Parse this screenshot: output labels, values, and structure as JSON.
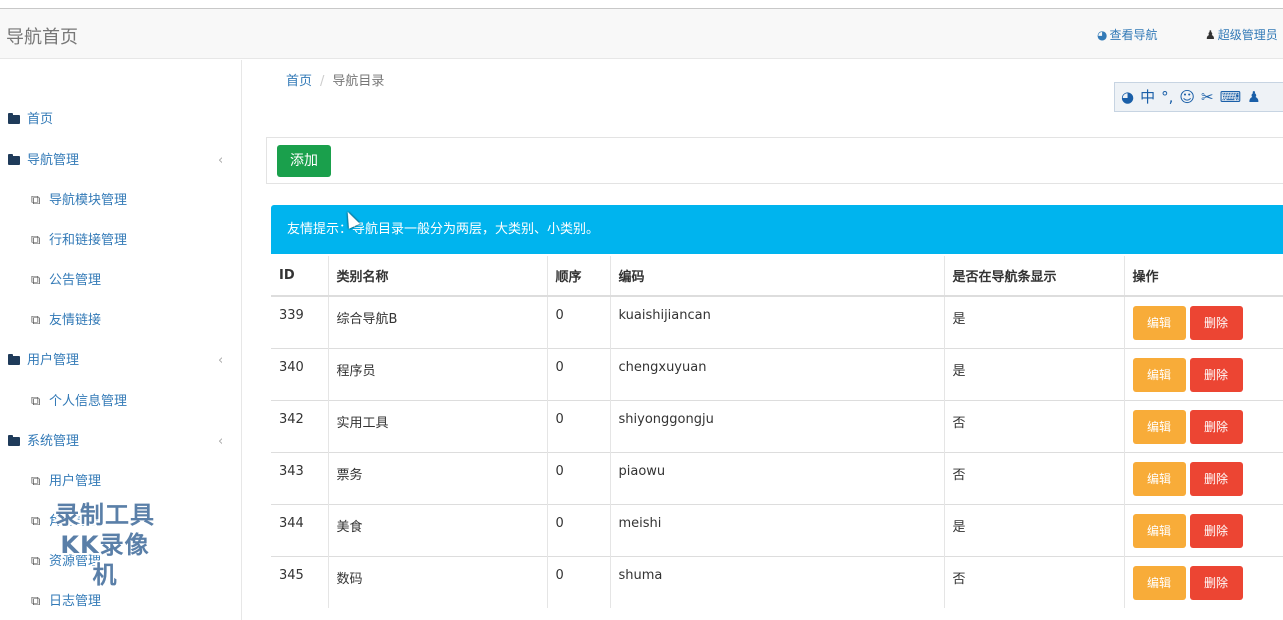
{
  "header": {
    "brand": "导航首页",
    "links": [
      {
        "icon": "globe-icon",
        "glyph": "◕",
        "label": "查看导航"
      },
      {
        "icon": "user-icon",
        "glyph": "♟",
        "label": "超级管理员"
      }
    ]
  },
  "sidebar": {
    "items": [
      {
        "type": "section",
        "label": "首页",
        "arrow": ""
      },
      {
        "type": "section",
        "label": "导航管理",
        "arrow": "‹"
      },
      {
        "type": "sub",
        "label": "导航模块管理"
      },
      {
        "type": "sub",
        "label": "行和链接管理"
      },
      {
        "type": "sub",
        "label": "公告管理"
      },
      {
        "type": "sub",
        "label": "友情链接"
      },
      {
        "type": "section",
        "label": "用户管理",
        "arrow": "‹"
      },
      {
        "type": "sub",
        "label": "个人信息管理"
      },
      {
        "type": "section",
        "label": "系统管理",
        "arrow": "‹"
      },
      {
        "type": "sub",
        "label": "用户管理"
      },
      {
        "type": "sub",
        "label": "角色管理"
      },
      {
        "type": "sub",
        "label": "资源管理"
      },
      {
        "type": "sub",
        "label": "日志管理"
      }
    ]
  },
  "breadcrumb": {
    "home": "首页",
    "current": "导航目录"
  },
  "ime_toolbar": {
    "chars": [
      "◕",
      "中",
      "°,",
      "☺",
      "✂",
      "⌨",
      "♟"
    ]
  },
  "toolbar": {
    "add_label": "添加"
  },
  "tip": {
    "text": "友情提示：导航目录一般分为两层，大类别、小类别。"
  },
  "table": {
    "headers": [
      "ID",
      "类别名称",
      "顺序",
      "编码",
      "是否在导航条显示",
      "操作"
    ],
    "edit_label": "编辑",
    "delete_label": "删除",
    "rows": [
      {
        "id": "339",
        "name": "综合导航B",
        "order": "0",
        "code": "kuaishijiancan",
        "show": "是"
      },
      {
        "id": "340",
        "name": "程序员",
        "order": "0",
        "code": "chengxuyuan",
        "show": "是"
      },
      {
        "id": "342",
        "name": "实用工具",
        "order": "0",
        "code": "shiyonggongju",
        "show": "否"
      },
      {
        "id": "343",
        "name": "票务",
        "order": "0",
        "code": "piaowu",
        "show": "否"
      },
      {
        "id": "344",
        "name": "美食",
        "order": "0",
        "code": "meishi",
        "show": "是"
      },
      {
        "id": "345",
        "name": "数码",
        "order": "0",
        "code": "shuma",
        "show": "否"
      }
    ]
  },
  "watermark": {
    "line1": "录制工具",
    "line2": "KK录像机"
  },
  "colors": {
    "add": "#1aa04c",
    "edit": "#f8ac39",
    "delete": "#ec4533",
    "tip": "#00b4ee",
    "link": "#337ab7"
  }
}
